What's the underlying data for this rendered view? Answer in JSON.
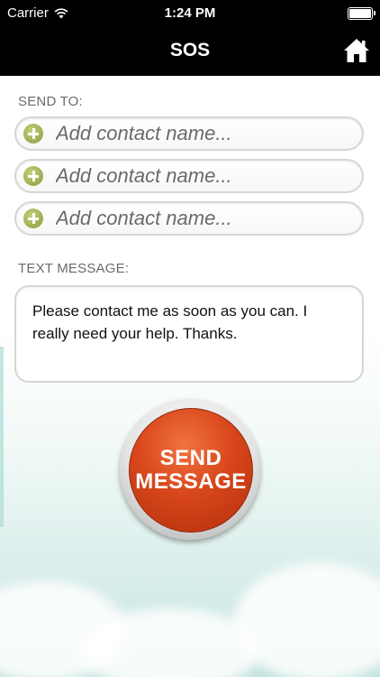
{
  "status_bar": {
    "carrier": "Carrier",
    "time": "1:24 PM",
    "wifi_icon": "wifi-icon",
    "battery_icon": "battery-icon"
  },
  "nav": {
    "title": "SOS",
    "home_icon": "home-icon"
  },
  "send_to": {
    "label": "SEND TO:",
    "fields": [
      {
        "placeholder": "Add contact name...",
        "icon": "add-contact-icon"
      },
      {
        "placeholder": "Add contact name...",
        "icon": "add-contact-icon"
      },
      {
        "placeholder": "Add contact name...",
        "icon": "add-contact-icon"
      }
    ]
  },
  "message": {
    "label": "TEXT MESSAGE:",
    "text": "Please contact me as soon as you can.  I really need your help.  Thanks."
  },
  "send_button": {
    "line1": "SEND",
    "line2": "MESSAGE",
    "color": "#d8461b"
  },
  "colors": {
    "bar_background": "#000000",
    "label": "#6b6b6b",
    "accent_green": "#8e9a3a"
  }
}
